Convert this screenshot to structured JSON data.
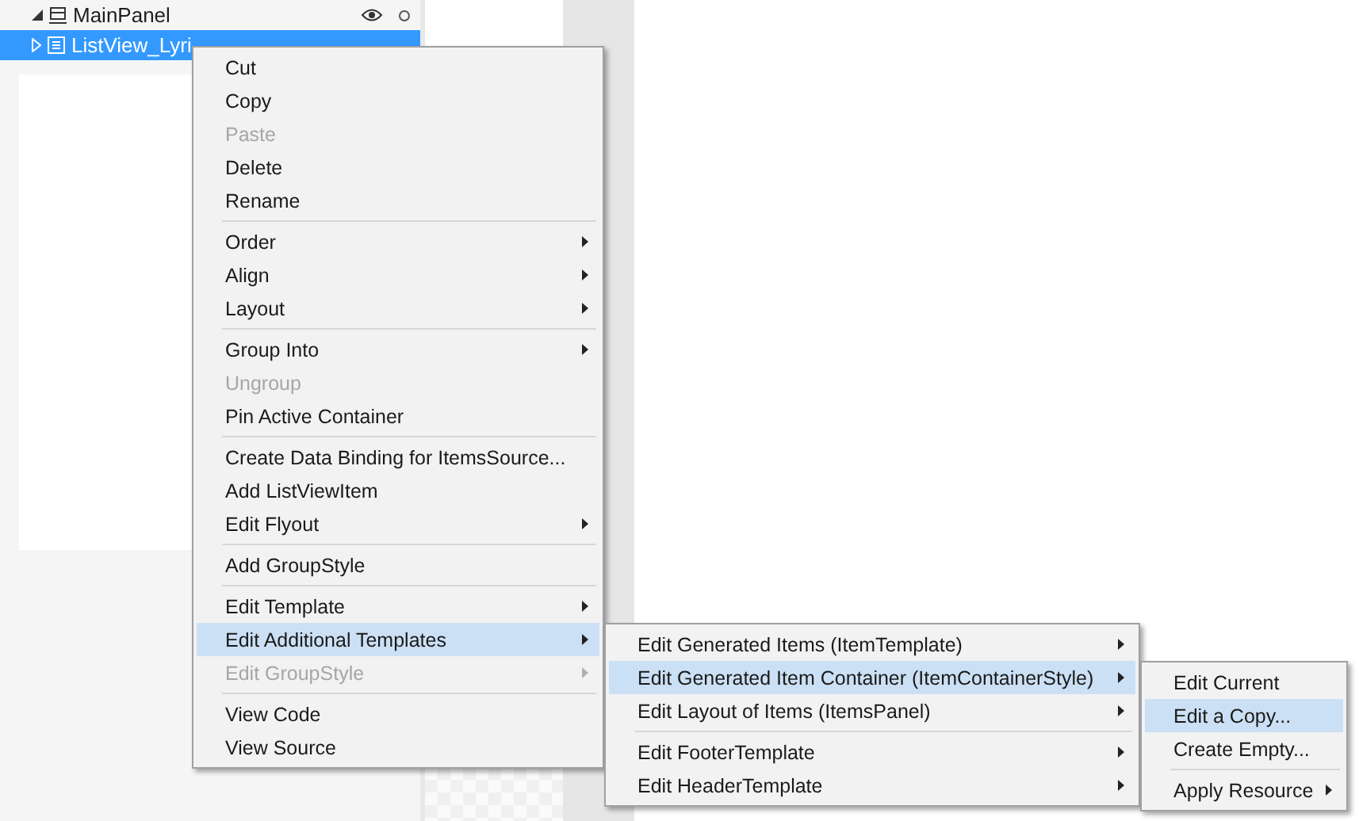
{
  "tree": [
    {
      "label": "MainPanel",
      "expanded": true,
      "selected": false
    },
    {
      "label": "ListView_Lyri",
      "expanded": false,
      "selected": true
    }
  ],
  "menus": [
    {
      "items": [
        {
          "kind": "item",
          "label": "Cut",
          "disabled": false,
          "submenu": false,
          "selected": false
        },
        {
          "kind": "item",
          "label": "Copy",
          "disabled": false,
          "submenu": false,
          "selected": false
        },
        {
          "kind": "item",
          "label": "Paste",
          "disabled": true,
          "submenu": false,
          "selected": false
        },
        {
          "kind": "item",
          "label": "Delete",
          "disabled": false,
          "submenu": false,
          "selected": false
        },
        {
          "kind": "item",
          "label": "Rename",
          "disabled": false,
          "submenu": false,
          "selected": false
        },
        {
          "kind": "separator"
        },
        {
          "kind": "item",
          "label": "Order",
          "disabled": false,
          "submenu": true,
          "selected": false
        },
        {
          "kind": "item",
          "label": "Align",
          "disabled": false,
          "submenu": true,
          "selected": false
        },
        {
          "kind": "item",
          "label": "Layout",
          "disabled": false,
          "submenu": true,
          "selected": false
        },
        {
          "kind": "separator"
        },
        {
          "kind": "item",
          "label": "Group Into",
          "disabled": false,
          "submenu": true,
          "selected": false
        },
        {
          "kind": "item",
          "label": "Ungroup",
          "disabled": true,
          "submenu": false,
          "selected": false
        },
        {
          "kind": "item",
          "label": "Pin Active Container",
          "disabled": false,
          "submenu": false,
          "selected": false
        },
        {
          "kind": "separator"
        },
        {
          "kind": "item",
          "label": "Create Data Binding for ItemsSource...",
          "disabled": false,
          "submenu": false,
          "selected": false
        },
        {
          "kind": "item",
          "label": "Add ListViewItem",
          "disabled": false,
          "submenu": false,
          "selected": false
        },
        {
          "kind": "item",
          "label": "Edit Flyout",
          "disabled": false,
          "submenu": true,
          "selected": false
        },
        {
          "kind": "separator"
        },
        {
          "kind": "item",
          "label": "Add GroupStyle",
          "disabled": false,
          "submenu": false,
          "selected": false
        },
        {
          "kind": "separator"
        },
        {
          "kind": "item",
          "label": "Edit Template",
          "disabled": false,
          "submenu": true,
          "selected": false
        },
        {
          "kind": "item",
          "label": "Edit Additional Templates",
          "disabled": false,
          "submenu": true,
          "selected": true
        },
        {
          "kind": "item",
          "label": "Edit GroupStyle",
          "disabled": true,
          "submenu": true,
          "selected": false
        },
        {
          "kind": "separator"
        },
        {
          "kind": "item",
          "label": "View Code",
          "disabled": false,
          "submenu": false,
          "selected": false
        },
        {
          "kind": "item",
          "label": "View Source",
          "disabled": false,
          "submenu": false,
          "selected": false
        }
      ]
    },
    {
      "items": [
        {
          "kind": "item",
          "label": "Edit Generated Items (ItemTemplate)",
          "disabled": false,
          "submenu": true,
          "selected": false
        },
        {
          "kind": "item",
          "label": "Edit Generated Item Container (ItemContainerStyle)",
          "disabled": false,
          "submenu": true,
          "selected": true
        },
        {
          "kind": "item",
          "label": "Edit Layout of Items (ItemsPanel)",
          "disabled": false,
          "submenu": true,
          "selected": false
        },
        {
          "kind": "separator"
        },
        {
          "kind": "item",
          "label": "Edit FooterTemplate",
          "disabled": false,
          "submenu": true,
          "selected": false
        },
        {
          "kind": "item",
          "label": "Edit HeaderTemplate",
          "disabled": false,
          "submenu": true,
          "selected": false
        }
      ]
    },
    {
      "items": [
        {
          "kind": "item",
          "label": "Edit Current",
          "disabled": false,
          "submenu": false,
          "selected": false
        },
        {
          "kind": "item",
          "label": "Edit a Copy...",
          "disabled": false,
          "submenu": false,
          "selected": true
        },
        {
          "kind": "item",
          "label": "Create Empty...",
          "disabled": false,
          "submenu": false,
          "selected": false
        },
        {
          "kind": "separator"
        },
        {
          "kind": "item",
          "label": "Apply Resource",
          "disabled": false,
          "submenu": true,
          "selected": false
        }
      ]
    }
  ]
}
